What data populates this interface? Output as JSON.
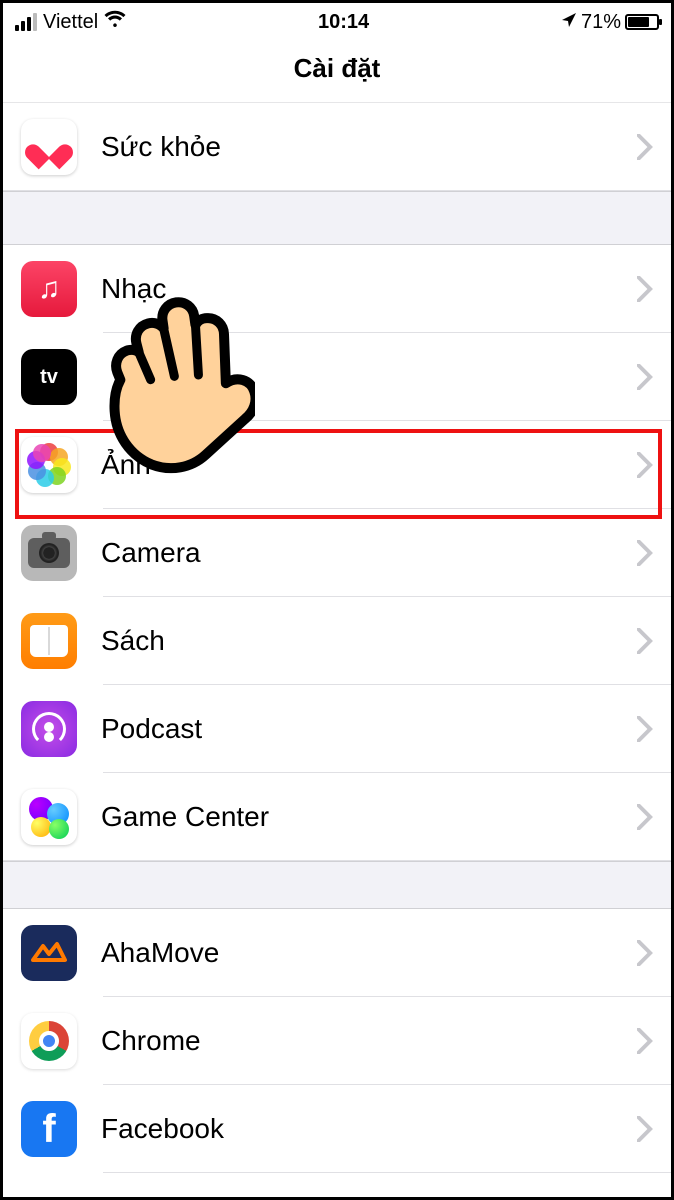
{
  "statusbar": {
    "carrier": "Viettel",
    "time": "10:14",
    "battery_pct": "71%"
  },
  "header": {
    "title": "Cài đặt"
  },
  "groups": {
    "g1": [
      {
        "id": "health",
        "label": "Sức khỏe",
        "icon": "health-icon"
      }
    ],
    "g2": [
      {
        "id": "music",
        "label": "Nhạc",
        "icon": "music-icon"
      },
      {
        "id": "tv",
        "label": "",
        "icon": "tv-icon"
      },
      {
        "id": "photos",
        "label": "Ảnh",
        "icon": "photos-icon",
        "highlighted": true
      },
      {
        "id": "camera",
        "label": "Camera",
        "icon": "camera-icon"
      },
      {
        "id": "books",
        "label": "Sách",
        "icon": "books-icon"
      },
      {
        "id": "podcasts",
        "label": "Podcast",
        "icon": "podcasts-icon"
      },
      {
        "id": "gamecenter",
        "label": "Game Center",
        "icon": "gamecenter-icon"
      }
    ],
    "g3": [
      {
        "id": "ahamove",
        "label": "AhaMove",
        "icon": "ahamove-icon"
      },
      {
        "id": "chrome",
        "label": "Chrome",
        "icon": "chrome-icon"
      },
      {
        "id": "facebook",
        "label": "Facebook",
        "icon": "facebook-icon"
      }
    ]
  },
  "tv_icon_text": "tv",
  "annotations": {
    "hand_pointer_target": "photos"
  }
}
